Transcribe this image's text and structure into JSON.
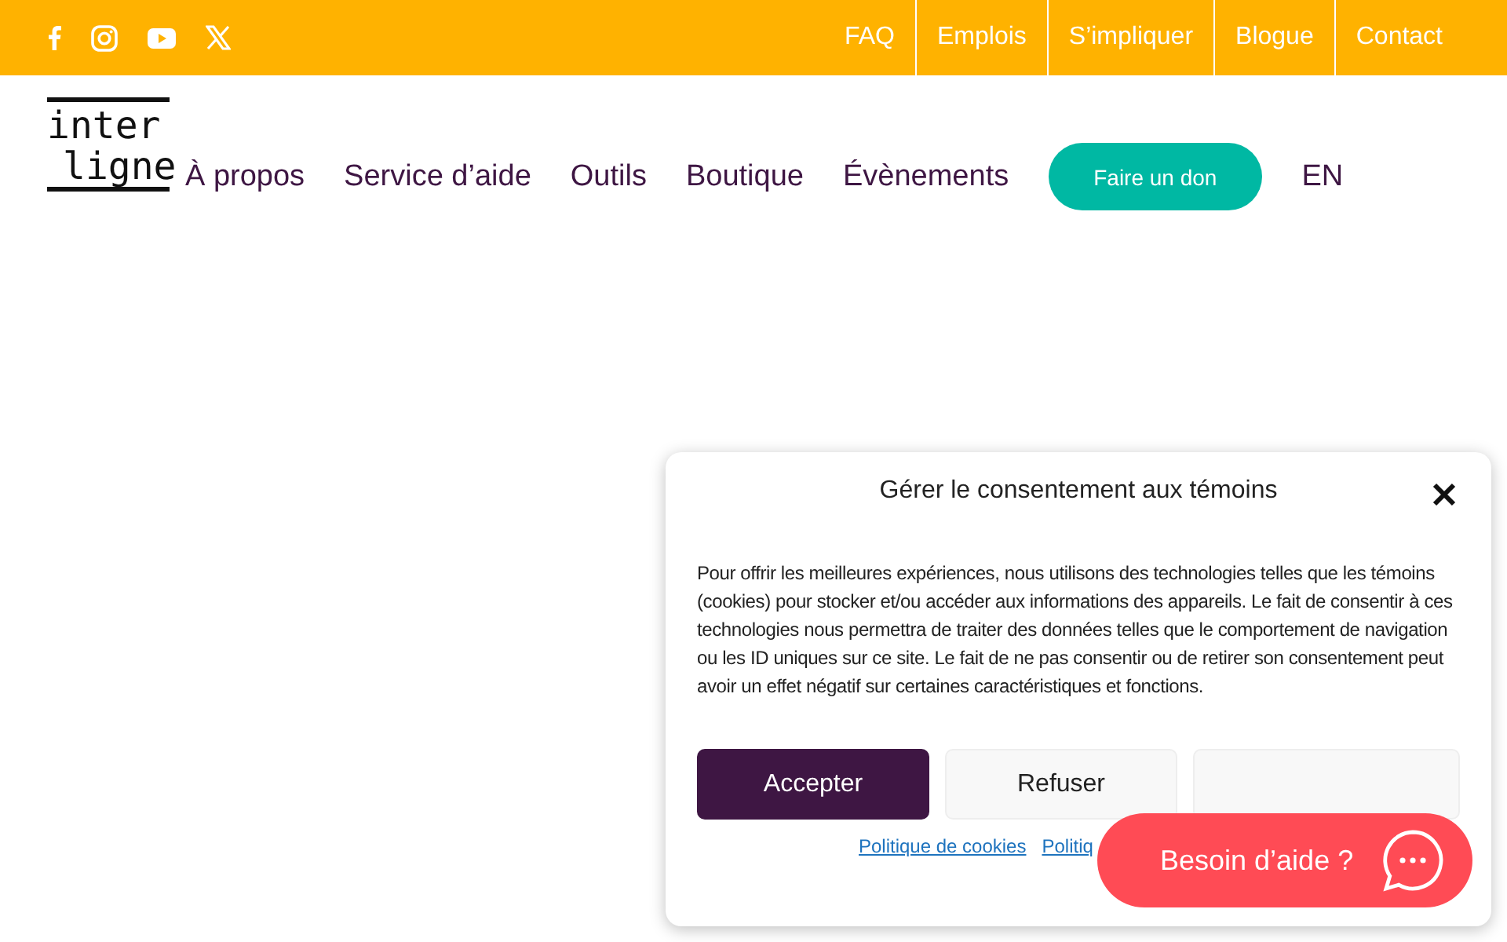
{
  "topbar": {
    "social": [
      {
        "kind": "facebook"
      },
      {
        "kind": "instagram"
      },
      {
        "kind": "youtube"
      },
      {
        "kind": "x"
      }
    ],
    "links": [
      "FAQ",
      "Emplois",
      "S’impliquer",
      "Blogue",
      "Contact"
    ]
  },
  "logo": {
    "line_1": "inter",
    "line_2": "ligne"
  },
  "nav": {
    "items": [
      "À propos",
      "Service d’aide",
      "Outils",
      "Boutique",
      "Évènements"
    ],
    "donate": "Faire un don",
    "language": "EN"
  },
  "consent_dialog": {
    "title": "Gérer le consentement aux témoins",
    "body": "Pour offrir les meilleures expériences, nous utilisons des technologies telles que les témoins (cookies) pour stocker et/ou accéder aux informations des appareils. Le fait de consentir à ces technologies nous permettra de traiter des données telles que le comportement de navigation ou les ID uniques sur ce site. Le fait de ne pas consentir ou de retirer son consentement peut avoir un effet négatif sur certaines caractéristiques et fonctions.",
    "buttons": [
      {
        "label": "Accepter",
        "kind": "primary"
      },
      {
        "label": "Refuser",
        "kind": "secondary"
      },
      {
        "kind": "covered"
      }
    ],
    "links": [
      "Politique de cookies",
      "Politiq"
    ]
  },
  "chat_button": {
    "label": "Besoin d’aide ?"
  }
}
